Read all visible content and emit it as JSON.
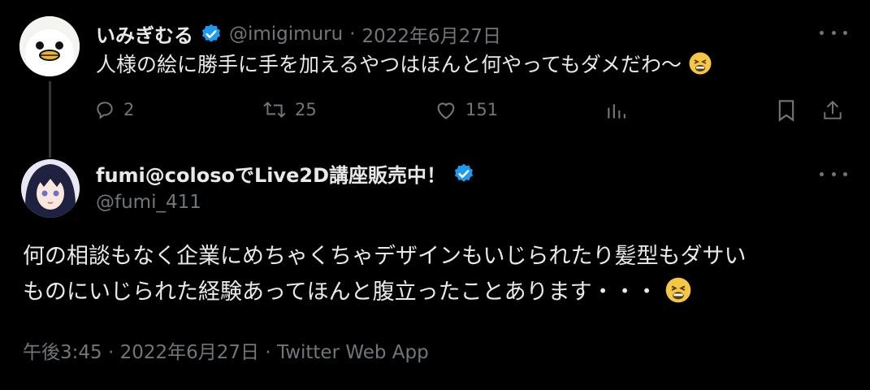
{
  "tweet1": {
    "display_name": "いみぎむる",
    "handle": "@imigimuru",
    "separator": "·",
    "date": "2022年6月27日",
    "text": "人様の絵に勝手に手を加えるやつはほんと何やってもダメだわ〜",
    "replies": "2",
    "retweets": "25",
    "likes": "151"
  },
  "tweet2": {
    "display_name": "fumi@colosoでLive2D講座販売中！",
    "handle": "@fumi_411",
    "text_line1": "何の相談もなく企業にめちゃくちゃデザインもいじられたり髪型もダサい",
    "text_line2": "ものにいじられた経験あってほんと腹立ったことあります・・・",
    "timestamp": "午後3:45 · 2022年6月27日 · Twitter Web App"
  },
  "icons": {
    "verified": "verified-badge-icon",
    "emoji": "weary-face-emoji",
    "reply": "reply-icon",
    "retweet": "retweet-icon",
    "like": "heart-icon",
    "views": "analytics-icon",
    "bookmark": "bookmark-icon",
    "share": "share-icon",
    "more": "more-icon"
  },
  "colors": {
    "background": "#000000",
    "text": "#e7e9ea",
    "muted": "#71767b",
    "verified": "#1d9bf0"
  }
}
